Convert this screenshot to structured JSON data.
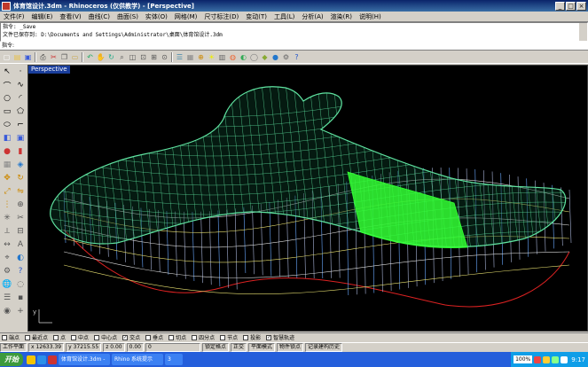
{
  "window": {
    "title": "体育馆设计.3dm - Rhinoceros (仅供教学) - [Perspective]",
    "controls": [
      "_",
      "□",
      "×"
    ]
  },
  "menu": [
    "文件(F)",
    "编辑(E)",
    "查看(V)",
    "曲线(C)",
    "曲面(S)",
    "实体(O)",
    "网格(M)",
    "尺寸标注(D)",
    "变动(T)",
    "工具(L)",
    "分析(A)",
    "渲染(R)",
    "说明(H)"
  ],
  "command_history": [
    "指令: _Save",
    "文件已保存到: D:\\Documents and Settings\\Administrator\\桌面\\体育馆设计.3dm"
  ],
  "command_prompt": "指令:",
  "viewport": {
    "label": "Perspective",
    "background": "#000000",
    "shell_color": "#5fe3a0",
    "highlight_color": "#33ff33",
    "axis_label": "y"
  },
  "toolbar_icons": [
    "new-icon",
    "open-icon",
    "save-icon",
    "print-icon",
    "cut-icon",
    "copy-icon",
    "paste-icon",
    "undo-icon",
    "pan-icon",
    "rotate-icon",
    "zoom-icon",
    "zoom-window-icon",
    "zoom-extents-icon",
    "zoom-selected-icon",
    "zoom-target-icon",
    "layers-icon",
    "properties-icon",
    "object-snap-icon",
    "light-bulb-icon",
    "grid-icon",
    "render-icon",
    "shaded-icon",
    "wireframe-icon",
    "material-icon",
    "sphere-icon",
    "options-icon",
    "help-icon"
  ],
  "osnap": [
    {
      "label": "端点",
      "checked": false
    },
    {
      "label": "最近点",
      "checked": false
    },
    {
      "label": "点",
      "checked": false
    },
    {
      "label": "中点",
      "checked": false
    },
    {
      "label": "中心点",
      "checked": false
    },
    {
      "label": "交点",
      "checked": true
    },
    {
      "label": "垂点",
      "checked": false
    },
    {
      "label": "切点",
      "checked": false
    },
    {
      "label": "四分点",
      "checked": false
    },
    {
      "label": "节点",
      "checked": false
    },
    {
      "label": "投影",
      "checked": false
    },
    {
      "label": "智慧轨迹",
      "checked": true
    }
  ],
  "status": {
    "cplane": "工作平面",
    "x": "x 12633.39",
    "y": "y 37215.55",
    "z": "z 0.00",
    "extra": "0.00",
    "layer": "0",
    "snap": "锁定格点",
    "ortho": "正交",
    "planar": "平面模式",
    "osnap": "物件锁点",
    "history": "记录建构历史"
  },
  "taskbar": {
    "start": "开始",
    "tasks": [
      "体育馆设计.3dm -",
      "Rhino 系统提示",
      "3"
    ],
    "zoom": "100%",
    "clock": "9:17"
  }
}
